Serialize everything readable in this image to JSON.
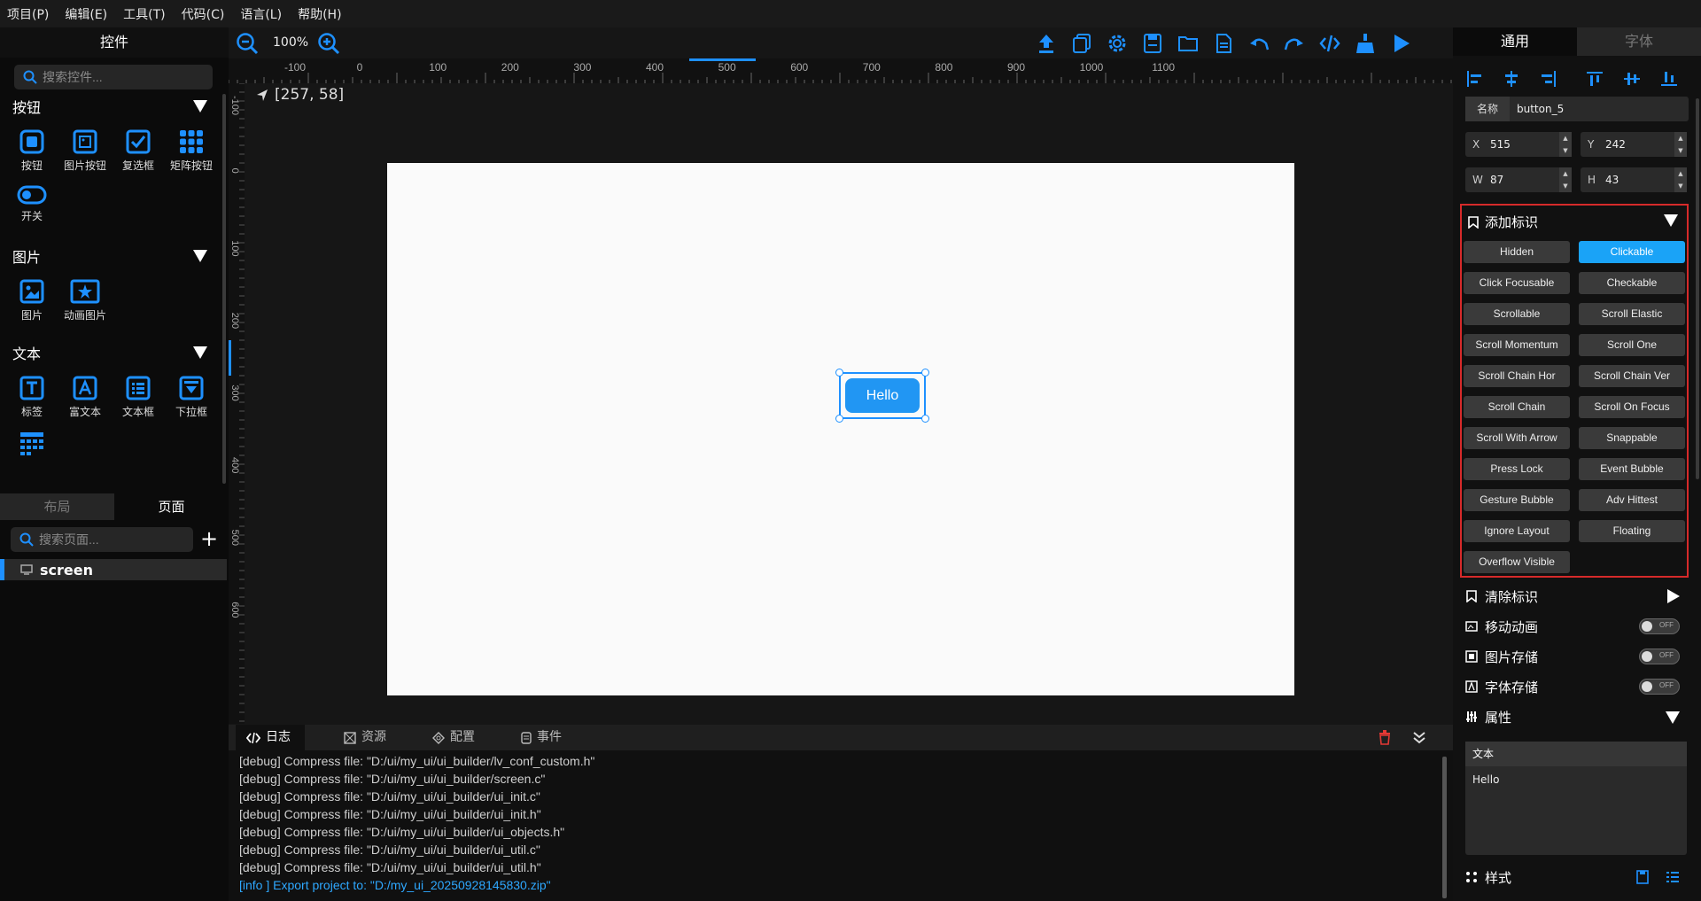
{
  "menu": [
    "项目(P)",
    "编辑(E)",
    "工具(T)",
    "代码(C)",
    "语言(L)",
    "帮助(H)"
  ],
  "left": {
    "title": "控件",
    "search_placeholder": "搜索控件...",
    "sections": {
      "buttons": {
        "title": "按钮",
        "items": [
          "按钮",
          "图片按钮",
          "复选框",
          "矩阵按钮",
          "开关"
        ]
      },
      "images": {
        "title": "图片",
        "items": [
          "图片",
          "动画图片"
        ]
      },
      "text": {
        "title": "文本",
        "items": [
          "标签",
          "富文本",
          "文本框",
          "下拉框"
        ]
      }
    },
    "tabs": [
      "布局",
      "页面"
    ],
    "page_search_placeholder": "搜索页面...",
    "add_label": "+",
    "pages": [
      "screen"
    ]
  },
  "canvas": {
    "zoom": "100%",
    "coord": "[257, 58]",
    "hruler": [
      "-100",
      "0",
      "100",
      "200",
      "300",
      "400",
      "500",
      "600",
      "700",
      "800",
      "900",
      "1000",
      "1100"
    ],
    "vruler": [
      "-100",
      "0",
      "100",
      "200",
      "300",
      "400",
      "500",
      "600"
    ],
    "button_text": "Hello"
  },
  "bottom": {
    "tabs": [
      "日志",
      "资源",
      "配置",
      "事件"
    ],
    "log": [
      "[debug] Compress file: \"D:/ui/my_ui/ui_builder/lv_conf_custom.h\"",
      "[debug] Compress file: \"D:/ui/my_ui/ui_builder/screen.c\"",
      "[debug] Compress file: \"D:/ui/my_ui/ui_builder/ui_init.c\"",
      "[debug] Compress file: \"D:/ui/my_ui/ui_builder/ui_init.h\"",
      "[debug] Compress file: \"D:/ui/my_ui/ui_builder/ui_objects.h\"",
      "[debug] Compress file: \"D:/ui/my_ui/ui_builder/ui_util.c\"",
      "[debug] Compress file: \"D:/ui/my_ui/ui_builder/ui_util.h\"",
      "[info ] Export project to: \"D:/my_ui_20250928145830.zip\""
    ]
  },
  "right": {
    "tabs": [
      "通用",
      "字体"
    ],
    "name_label": "名称",
    "name_value": "button_5",
    "x_label": "X",
    "x": "515",
    "y_label": "Y",
    "y": "242",
    "w_label": "W",
    "w": "87",
    "h_label": "H",
    "h": "43",
    "add_flags_title": "添加标识",
    "flags": [
      {
        "label": "Hidden",
        "active": false
      },
      {
        "label": "Clickable",
        "active": true
      },
      {
        "label": "Click Focusable",
        "active": false
      },
      {
        "label": "Checkable",
        "active": false
      },
      {
        "label": "Scrollable",
        "active": false
      },
      {
        "label": "Scroll Elastic",
        "active": false
      },
      {
        "label": "Scroll Momentum",
        "active": false
      },
      {
        "label": "Scroll One",
        "active": false
      },
      {
        "label": "Scroll Chain Hor",
        "active": false
      },
      {
        "label": "Scroll Chain Ver",
        "active": false
      },
      {
        "label": "Scroll Chain",
        "active": false
      },
      {
        "label": "Scroll On Focus",
        "active": false
      },
      {
        "label": "Scroll With Arrow",
        "active": false
      },
      {
        "label": "Snappable",
        "active": false
      },
      {
        "label": "Press Lock",
        "active": false
      },
      {
        "label": "Event Bubble",
        "active": false
      },
      {
        "label": "Gesture Bubble",
        "active": false
      },
      {
        "label": "Adv Hittest",
        "active": false
      },
      {
        "label": "Ignore Layout",
        "active": false
      },
      {
        "label": "Floating",
        "active": false
      },
      {
        "label": "Overflow Visible",
        "active": false
      }
    ],
    "clear_flags_title": "清除标识",
    "move_anim": "移动动画",
    "img_store": "图片存储",
    "font_store": "字体存储",
    "toggle_off": "OFF",
    "props_title": "属性",
    "text_label": "文本",
    "text_value": "Hello",
    "style_title": "样式"
  },
  "colors": {
    "accent": "#1e90ff",
    "active_flag": "#1aa3f7",
    "highlight_border": "#d62a2a"
  }
}
